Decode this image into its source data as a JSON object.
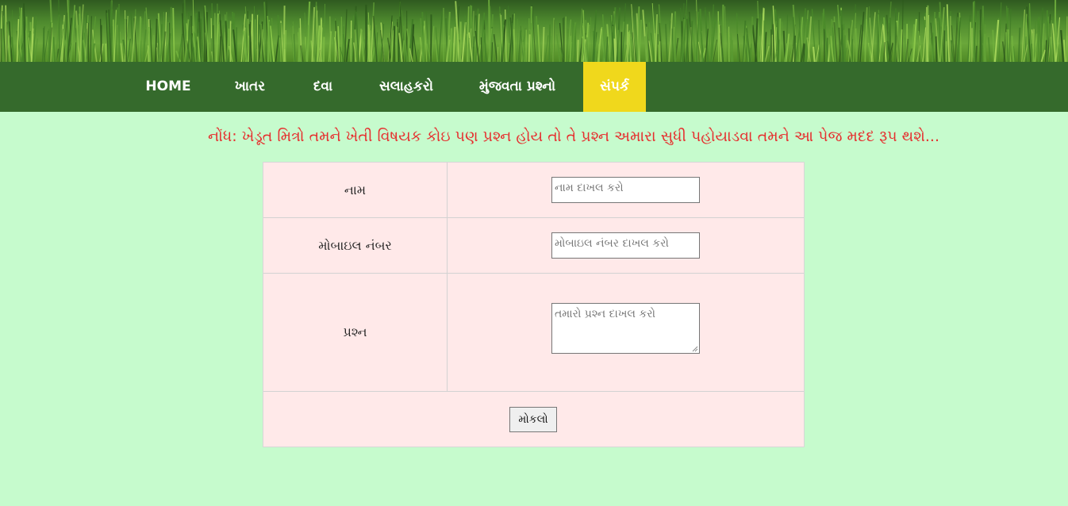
{
  "nav": {
    "items": [
      {
        "label": "HOME",
        "active": false
      },
      {
        "label": "ખાતર",
        "active": false
      },
      {
        "label": "દવા",
        "active": false
      },
      {
        "label": "સલાહકરો",
        "active": false
      },
      {
        "label": "મુંજવતા પ્રશ્નો",
        "active": false
      },
      {
        "label": "સંપર્ક",
        "active": true
      }
    ]
  },
  "notice": "નોંધ: ખેડૂત મિત્રો તમને ખેતી વિષયક કોઇ પણ પ્રશ્ન હોય તો તે પ્રશ્ન અમારા સુધી પહોયાડવા તમને આ પેજ મદદ રૂપ થશે...",
  "form": {
    "name_label": "નામ",
    "name_placeholder": "નામ દાખલ કરો",
    "mobile_label": "મોબાઇલ નંબર",
    "mobile_placeholder": "મોબાઇલ નંબર દાખલ કરો",
    "question_label": "પ્રશ્ન",
    "question_placeholder": "તમારો પ્રશ્ન દાખલ કરો",
    "submit_label": "મોકલો"
  },
  "colors": {
    "background": "#c6fbcd",
    "nav_bg": "#356a2c",
    "nav_active": "#f0d81c",
    "notice_text": "#e62e2e",
    "form_bg": "#ffe9e9"
  }
}
